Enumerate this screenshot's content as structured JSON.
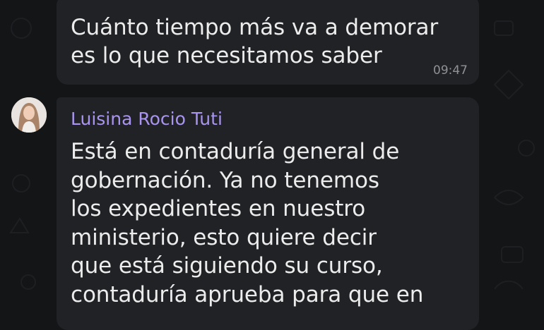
{
  "messages": [
    {
      "text": "Cuánto tiempo más va a demorar\nes lo que necesitamos saber",
      "time": "09:47"
    },
    {
      "sender": "Luisina Rocio Tuti",
      "text": "Está en contaduría general de\ngobernación. Ya no tenemos\nlos expedientes en nuestro\nministerio, esto quiere decir\nque está siguiendo su curso,\ncontaduría aprueba para que en"
    }
  ],
  "colors": {
    "background": "#141517",
    "bubble": "#212225",
    "text": "#ececec",
    "sender_name": "#a994ef",
    "timestamp": "#8e9196"
  },
  "icons": [
    "avatar-photo"
  ]
}
